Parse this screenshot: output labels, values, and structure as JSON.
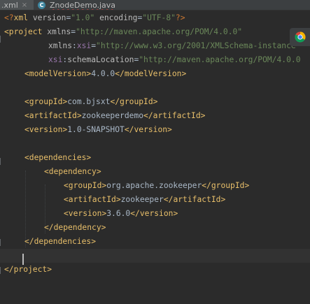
{
  "tabs": [
    {
      "label": ".xml",
      "close": "×"
    },
    {
      "label": "ZnodeDemo.java",
      "icon": "java-class-icon"
    }
  ],
  "code": {
    "pi": {
      "open": "<?",
      "name": "xml",
      "attr1": "version",
      "val1": "\"1.0\"",
      "attr2": "encoding",
      "val2": "\"UTF-8\"",
      "close": "?>"
    },
    "project_open": {
      "tag": "<project",
      "attr": "xmlns",
      "val": "\"http://maven.apache.org/POM/4.0.0\""
    },
    "xsi_line": {
      "ns": "xmlns",
      "prefix": "xsi",
      "val": "\"http://www.w3.org/2001/XMLSchema-instance\""
    },
    "schema_line": {
      "prefix": "xsi",
      "attr": "schemaLocation",
      "val": "\"http://maven.apache.org/POM/4.0.0"
    },
    "model_version": {
      "open": "<modelVersion>",
      "text": "4.0.0",
      "close": "</modelVersion>"
    },
    "group_id": {
      "open": "<groupId>",
      "text": "com.bjsxt",
      "close": "</groupId>"
    },
    "artifact_id": {
      "open": "<artifactId>",
      "text": "zookeeperdemo",
      "close": "</artifactId>"
    },
    "version": {
      "open": "<version>",
      "text": "1.0-SNAPSHOT",
      "close": "</version>"
    },
    "dependencies_open": "<dependencies>",
    "dependency_open": "<dependency>",
    "dep_group_id": {
      "open": "<groupId>",
      "text": "org.apache.zookeeper",
      "close": "</groupId>"
    },
    "dep_artifact_id": {
      "open": "<artifactId>",
      "text": "zookeeper",
      "close": "</artifactId>"
    },
    "dep_version": {
      "open": "<version>",
      "text": "3.6.0",
      "close": "</version>"
    },
    "dependency_close": "</dependency>",
    "dependencies_close": "</dependencies>",
    "project_close": "</project>"
  },
  "colors": {
    "background": "#2b2b2b",
    "tag": "#e8bf6a",
    "attribute": "#bababa",
    "namespace": "#9876aa",
    "value": "#6a8759",
    "text": "#a9b7c6"
  }
}
